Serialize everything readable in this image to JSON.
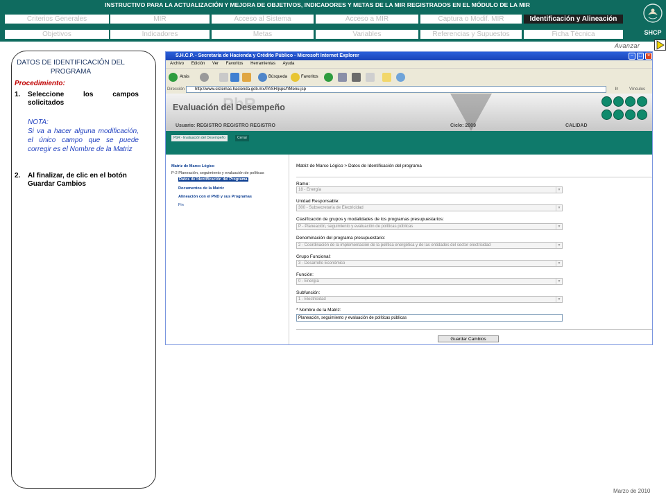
{
  "header": {
    "title": "INSTRUCTIVO PARA  LA ACTUALIZACIÓN Y MEJORA DE OBJETIVOS, INDICADORES Y METAS DE LA MIR REGISTRADOS EN EL MÓDULO DE LA MIR",
    "tabs_row1": [
      "Criterios Generales",
      "MIR",
      "Acceso al Sistema",
      "Acceso a MIR",
      "Captura o Modif. MIR",
      "Identificación y Alineación"
    ],
    "tabs_row2": [
      "Objetivos",
      "Indicadores",
      "Metas",
      "Variables",
      "Referencias y Supuestos",
      "Ficha Técnica"
    ],
    "logo_text": "SHCP",
    "avanzar": "Avanzar"
  },
  "panel": {
    "title": "DATOS DE IDENTIFICACIÓN DEL PROGRAMA",
    "procedure_label": "Procedimiento:",
    "step1_num": "1.",
    "step1_text": "Seleccione los campos solicitados",
    "note_label": "NOTA:",
    "note_text": "Si va a hacer alguna modificación, el único campo que se puede corregir es el Nombre de la Matriz",
    "step2_num": "2.",
    "step2_text": "Al finalizar, de clic en el botón Guardar Cambios"
  },
  "footer": {
    "date": "Marzo de 2010"
  },
  "browser": {
    "title": "S.H.C.P. - Secretaría de Hacienda y Crédito Público - Microsoft Internet Explorer",
    "menu": [
      "Archivo",
      "Edición",
      "Ver",
      "Favoritos",
      "Herramientas",
      "Ayuda"
    ],
    "back_label": "Atrás",
    "search_label": "Búsqueda",
    "favorites_label": "Favoritos",
    "address_label": "Dirección",
    "url": "http://www.sistemas.hacienda.gob.mx/PASH/jsps/frMenu.jsp",
    "go_label": "Ir",
    "links_label": "Vínculos"
  },
  "app": {
    "title": "Evaluación del Desempeño",
    "watermark": "PbR",
    "user": "Usuario: REGISTRO REGISTRO REGISTRO",
    "cycle": "Ciclo: 2009",
    "quality": "CALIDAD",
    "tab_active": "PbR - Evaluación del Desempeño",
    "tab_close": "Cerrar",
    "tree_root": "Matriz de Marco Lógico",
    "tree_program": "P-2 Planeación, seguimiento y evaluación de políticas",
    "tree_items": [
      "Datos de Identificación del Programa",
      "Documentos de la Matriz",
      "Alineación con el PND y sus Programas",
      "Fin"
    ],
    "breadcrumb": "Matriz de Marco Lógico > Datos de Identificación del programa",
    "fields": [
      {
        "label": "Ramo:",
        "value": "18 - Energía"
      },
      {
        "label": "Unidad Responsable:",
        "value": "300 - Subsecretaría de Electricidad"
      },
      {
        "label": "Clasificación de grupos y modalidades de los programas presupuestarios:",
        "value": "P - Planeación, seguimiento y evaluación de políticas públicas"
      },
      {
        "label": "Denominación del programa presupuestario:",
        "value": "2 - Coordinación de la implementación de la política energética y de las entidades del sector electricidad"
      },
      {
        "label": "Grupo Funcional:",
        "value": "3 - Desarrollo Económico"
      },
      {
        "label": "Función:",
        "value": "0 - Energía"
      },
      {
        "label": "Subfunción:",
        "value": "1 - Electricidad"
      }
    ],
    "matrix_label": "* Nombre de la Matriz:",
    "matrix_value": "Planeación, seguimiento y evaluación de políticas públicas",
    "save_label": "Guardar Cambios"
  },
  "colors": {
    "header_bg": "#0f6b5f",
    "active_tab": "#1f1f1f",
    "panel_title": "#1f3864",
    "procedure": "#c00000",
    "note": "#1f3fbf"
  }
}
